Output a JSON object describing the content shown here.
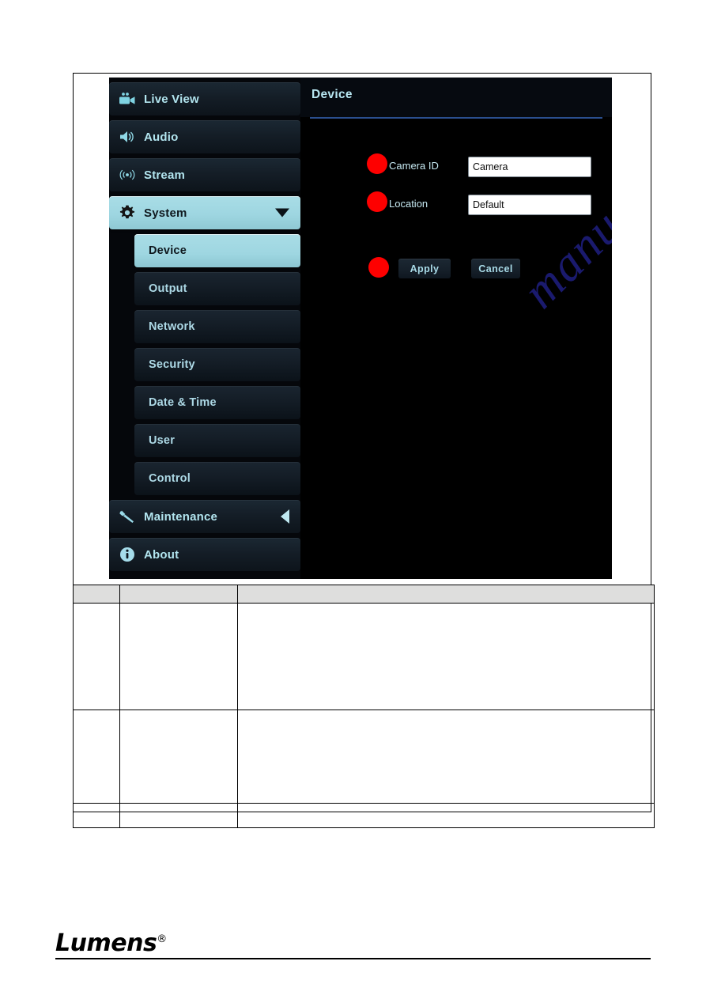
{
  "screenshot": {
    "sidebar": {
      "nav": [
        {
          "label": "Live View",
          "icon": "video-camera-icon",
          "active": false,
          "arrow": "none"
        },
        {
          "label": "Audio",
          "icon": "speaker-icon",
          "active": false,
          "arrow": "none"
        },
        {
          "label": "Stream",
          "icon": "broadcast-icon",
          "active": false,
          "arrow": "none"
        },
        {
          "label": "System",
          "icon": "gear-icon",
          "active": true,
          "arrow": "down"
        },
        {
          "label": "Maintenance",
          "icon": "wrench-icon",
          "active": false,
          "arrow": "left"
        },
        {
          "label": "About",
          "icon": "info-circle-icon",
          "active": false,
          "arrow": "none"
        }
      ],
      "submenu": [
        {
          "label": "Device",
          "active": true
        },
        {
          "label": "Output",
          "active": false
        },
        {
          "label": "Network",
          "active": false
        },
        {
          "label": "Security",
          "active": false
        },
        {
          "label": "Date & Time",
          "active": false
        },
        {
          "label": "User",
          "active": false
        },
        {
          "label": "Control",
          "active": false
        }
      ]
    },
    "panel": {
      "title": "Device",
      "fields": [
        {
          "label": "Camera ID",
          "value": "Camera"
        },
        {
          "label": "Location",
          "value": "Default"
        }
      ],
      "buttons": {
        "apply": "Apply",
        "cancel": "Cancel"
      }
    },
    "watermark": "manualshive.com",
    "colors": {
      "accent_cyan": "#b2e5ef",
      "highlight_cyan": "#9ed6e1",
      "panel_black": "#000000",
      "annotation_red": "#fe0000",
      "rule_blue": "#2a4f8f"
    }
  },
  "footer": {
    "brand": "Lumens",
    "registered_mark": "®"
  }
}
